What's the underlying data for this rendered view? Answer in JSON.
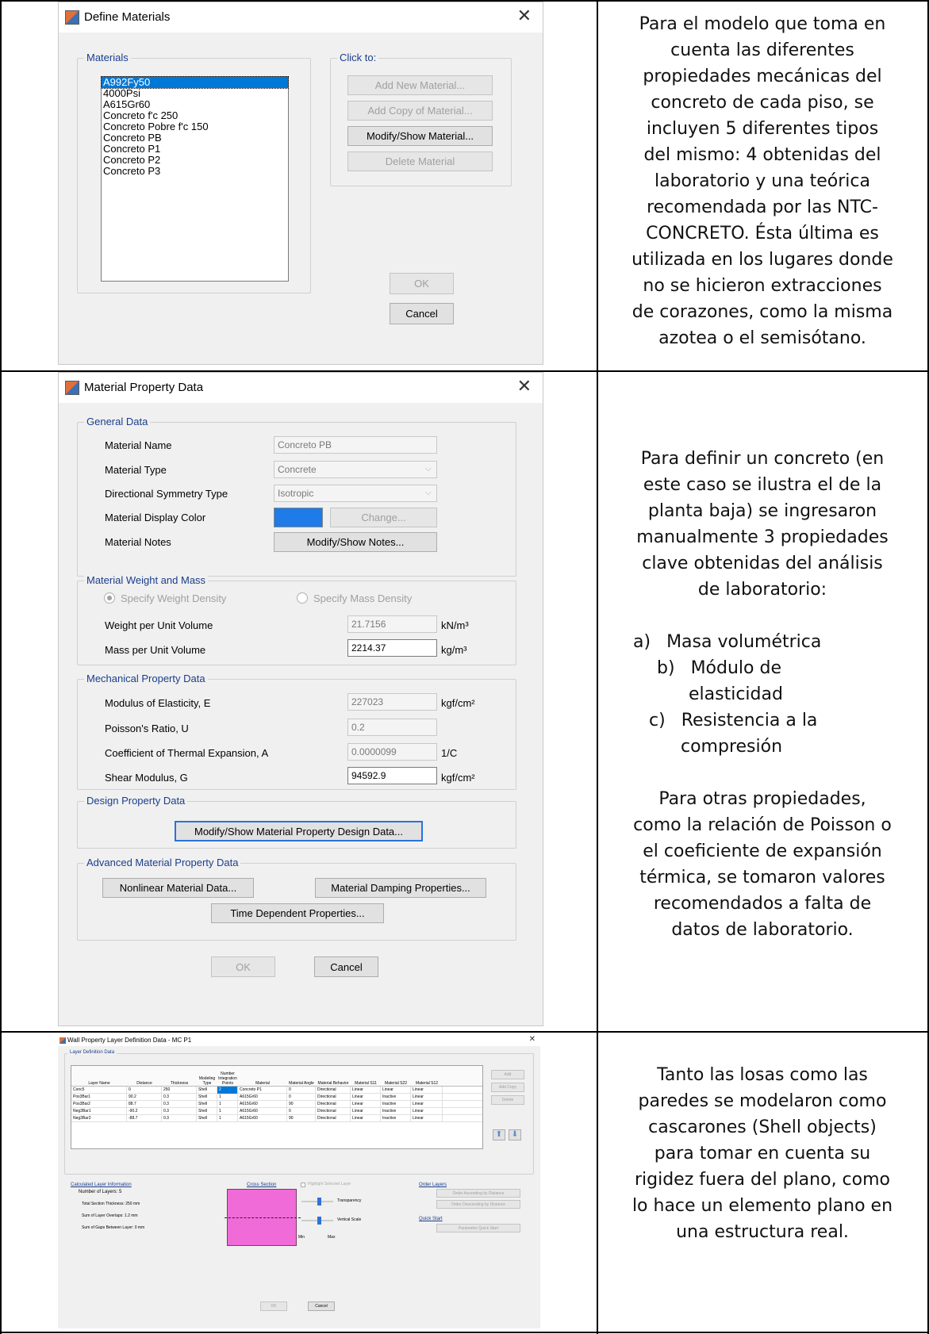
{
  "dialog1": {
    "title": "Define Materials",
    "materials_label": "Materials",
    "click_to_label": "Click to:",
    "materials": [
      "A992Fy50",
      "4000Psi",
      "A615Gr60",
      "Concreto f'c 250",
      "Concreto Pobre f'c 150",
      "Concreto PB",
      "Concreto P1",
      "Concreto P2",
      "Concreto P3"
    ],
    "selected_index": 0,
    "add_new_label": "Add New Material...",
    "add_copy_label": "Add Copy of Material...",
    "modify_show_label": "Modify/Show Material...",
    "delete_label": "Delete Material",
    "ok_label": "OK",
    "cancel_label": "Cancel"
  },
  "dialog2": {
    "title": "Material Property Data",
    "general_data_label": "General Data",
    "material_name_label": "Material Name",
    "material_name_value": "Concreto PB",
    "material_type_label": "Material Type",
    "material_type_value": "Concrete",
    "symmetry_label": "Directional Symmetry Type",
    "symmetry_value": "Isotropic",
    "display_color_label": "Material Display Color",
    "display_color": "#1e7be8",
    "change_label": "Change...",
    "notes_label": "Material Notes",
    "modify_notes_label": "Modify/Show Notes...",
    "weight_mass_label": "Material Weight and Mass",
    "specify_weight_label": "Specify Weight Density",
    "specify_mass_label": "Specify Mass Density",
    "weight_per_volume_label": "Weight per Unit Volume",
    "weight_per_volume_value": "21.7156",
    "weight_unit": "kN/m³",
    "mass_per_volume_label": "Mass per Unit Volume",
    "mass_per_volume_value": "2214.37",
    "mass_unit": "kg/m³",
    "mechanical_label": "Mechanical Property Data",
    "modulus_label": "Modulus of Elasticity,  E",
    "modulus_value": "227023",
    "modulus_unit": "kgf/cm²",
    "poisson_label": "Poisson's Ratio,  U",
    "poisson_value": "0.2",
    "thermal_label": "Coefficient of Thermal Expansion,  A",
    "thermal_value": "0.0000099",
    "thermal_unit": "1/C",
    "shear_label": "Shear Modulus,  G",
    "shear_value": "94592.9",
    "shear_unit": "kgf/cm²",
    "design_label": "Design Property Data",
    "design_button": "Modify/Show Material Property Design Data...",
    "advanced_label": "Advanced Material Property Data",
    "nonlinear_button": "Nonlinear Material Data...",
    "damping_button": "Material Damping Properties...",
    "time_button": "Time Dependent Properties...",
    "ok_label": "OK",
    "cancel_label": "Cancel"
  },
  "dialog3": {
    "title": "Wall Property Layer Definition Data - MC P1",
    "layer_def_label": "Layer Definition Data",
    "headers": [
      "Layer Name",
      "Distance",
      "Thickness",
      "Modeling Type",
      "Number Integration Points",
      "Material",
      "Material Angle",
      "Material Behavior",
      "Material S11",
      "Material S22",
      "Material S12"
    ],
    "rows": [
      [
        "Conc5",
        "0",
        "250",
        "Shell",
        "2",
        "Concreto P1",
        "0",
        "Directional",
        "Linear",
        "Linear",
        "Linear"
      ],
      [
        "Pos3Bar1",
        "90.2",
        "0.3",
        "Shell",
        "1",
        "A615Gr60",
        "0",
        "Directional",
        "Linear",
        "Inactive",
        "Linear"
      ],
      [
        "Pos3Bar2",
        "88.7",
        "0.3",
        "Shell",
        "1",
        "A615Gr60",
        "90",
        "Directional",
        "Linear",
        "Inactive",
        "Linear"
      ],
      [
        "Neg3Bar1",
        "-90.2",
        "0.3",
        "Shell",
        "1",
        "A615Gr60",
        "0",
        "Directional",
        "Linear",
        "Inactive",
        "Linear"
      ],
      [
        "Neg3Bar2",
        "-88.7",
        "0.3",
        "Shell",
        "1",
        "A615Gr60",
        "90",
        "Directional",
        "Linear",
        "Inactive",
        "Linear"
      ]
    ],
    "add_label": "Add",
    "add_copy_label": "Add Copy",
    "delete_label": "Delete",
    "calc_info_label": "Calculated Layer Information",
    "num_layers": "Number of Layers:  5",
    "total_thickness": "Total Section Thickness:  250 mm",
    "overlaps": "Sum of Layer Overlaps:  1.2 mm",
    "gaps": "Sum of Gaps Between Layer:  0 mm",
    "cross_section_label": "Cross Section",
    "highlight_label": "Highlight Selected Layer",
    "transparency_label": "Transparency",
    "vertical_scale_label": "Vertical Scale",
    "min_label": "Min",
    "max_label": "Max",
    "order_layers_label": "Order Layers",
    "order_asc": "Order Ascending by Distance",
    "order_desc": "Order Descending by Distance",
    "quick_start_label": "Quick Start",
    "param_quick_start": "Parametric Quick Start",
    "ok_label": "OK",
    "cancel_label": "Cancel"
  },
  "text1": [
    "Para el modelo que toma en",
    "cuenta las diferentes",
    "propiedades mecánicas del",
    "concreto de cada piso, se",
    "incluyen 5 diferentes tipos",
    "del mismo: 4 obtenidas del",
    "laboratorio y una teórica",
    "recomendada por las NTC-",
    "CONCRETO. Ésta última es",
    "utilizada en los lugares donde",
    "no se hicieron extracciones",
    "de corazones, como la misma",
    "azotea o el semisótano."
  ],
  "text2_intro": [
    "Para definir un concreto (en",
    "este caso se ilustra el de la",
    "planta baja) se ingresaron",
    "manualmente 3 propiedades",
    "clave obtenidas del análisis",
    "de laboratorio:"
  ],
  "text2_list": [
    {
      "marker": "a)",
      "text": "Masa volumétrica"
    },
    {
      "marker": "b)",
      "text": "Módulo de"
    },
    {
      "marker": "",
      "text": "elasticidad"
    },
    {
      "marker": "c)",
      "text": "Resistencia a la"
    },
    {
      "marker": "",
      "text": "compresión"
    }
  ],
  "text2_outro": [
    "Para otras propiedades,",
    "como la relación de Poisson o",
    "el coeficiente de expansión",
    "térmica, se tomaron valores",
    "recomendados a falta de",
    "datos de laboratorio."
  ],
  "text3": [
    "Tanto las losas como las",
    "paredes se modelaron como",
    "cascarones (Shell objects)",
    "para tomar en cuenta su",
    "rigidez fuera del plano, como",
    "lo hace un elemento plano en",
    "una estructura real."
  ]
}
